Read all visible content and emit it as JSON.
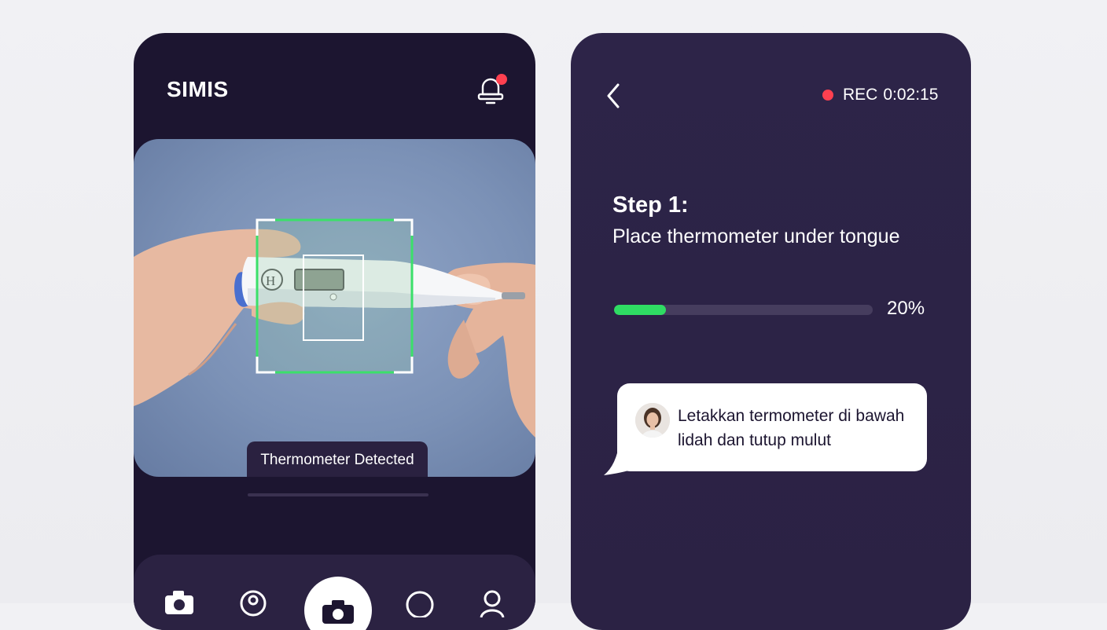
{
  "left_screen": {
    "brand": "SIMIS",
    "icons": {
      "notification": "bell-icon",
      "nav": [
        "camera-icon",
        "profile-icon",
        "shutter-camera-icon",
        "chat-icon",
        "user-icon"
      ]
    },
    "camera": {
      "detection_label": "Thermometer Detected"
    }
  },
  "right_screen": {
    "back_icon": "chevron-left-icon",
    "recording": {
      "label": "REC",
      "time": "0:02:15"
    },
    "step": {
      "title": "Step 1:",
      "instruction": "Place thermometer under tongue"
    },
    "progress": {
      "value": 0.2,
      "label": "20%"
    },
    "assistant_message": {
      "text": "Letakkan termometer di bawah lidah dan tutup mulut"
    }
  },
  "colors": {
    "background": "#eeeef2",
    "phone_dark": "#1c1530",
    "phone_purple": "#2d2448",
    "accent_green": "#2fdc63",
    "alert_red": "#ff4050"
  }
}
